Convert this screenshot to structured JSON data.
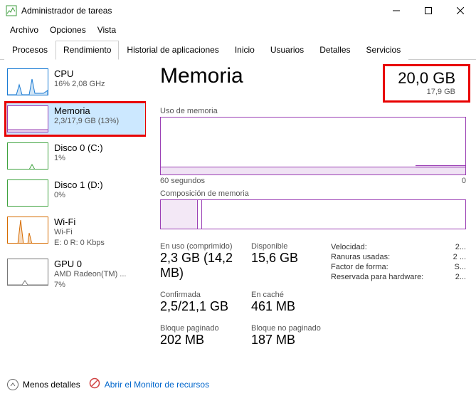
{
  "window": {
    "title": "Administrador de tareas"
  },
  "menu": {
    "file": "Archivo",
    "options": "Opciones",
    "view": "Vista"
  },
  "tabs": {
    "processes": "Procesos",
    "performance": "Rendimiento",
    "app_history": "Historial de aplicaciones",
    "startup": "Inicio",
    "users": "Usuarios",
    "details": "Detalles",
    "services": "Servicios"
  },
  "sidebar": {
    "cpu": {
      "name": "CPU",
      "sub": "16%  2,08 GHz"
    },
    "mem": {
      "name": "Memoria",
      "sub": "2,3/17,9 GB (13%)"
    },
    "disk0": {
      "name": "Disco 0 (C:)",
      "sub": "1%"
    },
    "disk1": {
      "name": "Disco 1 (D:)",
      "sub": "0%"
    },
    "wifi": {
      "name": "Wi-Fi",
      "sub1": "Wi-Fi",
      "sub2": "E: 0  R: 0 Kbps"
    },
    "gpu": {
      "name": "GPU 0",
      "sub1": "AMD Radeon(TM) ...",
      "sub2": "7%"
    }
  },
  "main": {
    "heading": "Memoria",
    "total": "20,0 GB",
    "total_sub": "17,9 GB",
    "usage_label": "Uso de memoria",
    "time_left": "60 segundos",
    "time_right": "0",
    "comp_label": "Composición de memoria",
    "stats": {
      "inuse_lbl": "En uso (comprimido)",
      "inuse_val": "2,3 GB (14,2 MB)",
      "avail_lbl": "Disponible",
      "avail_val": "15,6 GB",
      "commit_lbl": "Confirmada",
      "commit_val": "2,5/21,1 GB",
      "cached_lbl": "En caché",
      "cached_val": "461 MB",
      "paged_lbl": "Bloque paginado",
      "paged_val": "202 MB",
      "nonpaged_lbl": "Bloque no paginado",
      "nonpaged_val": "187 MB"
    },
    "kv": {
      "speed_k": "Velocidad:",
      "speed_v": "2...",
      "slots_k": "Ranuras usadas:",
      "slots_v": "2 ...",
      "form_k": "Factor de forma:",
      "form_v": "S...",
      "res_k": "Reservada para hardware:",
      "res_v": "2..."
    }
  },
  "footer": {
    "fewer": "Menos detalles",
    "monitor": "Abrir el Monitor de recursos"
  }
}
